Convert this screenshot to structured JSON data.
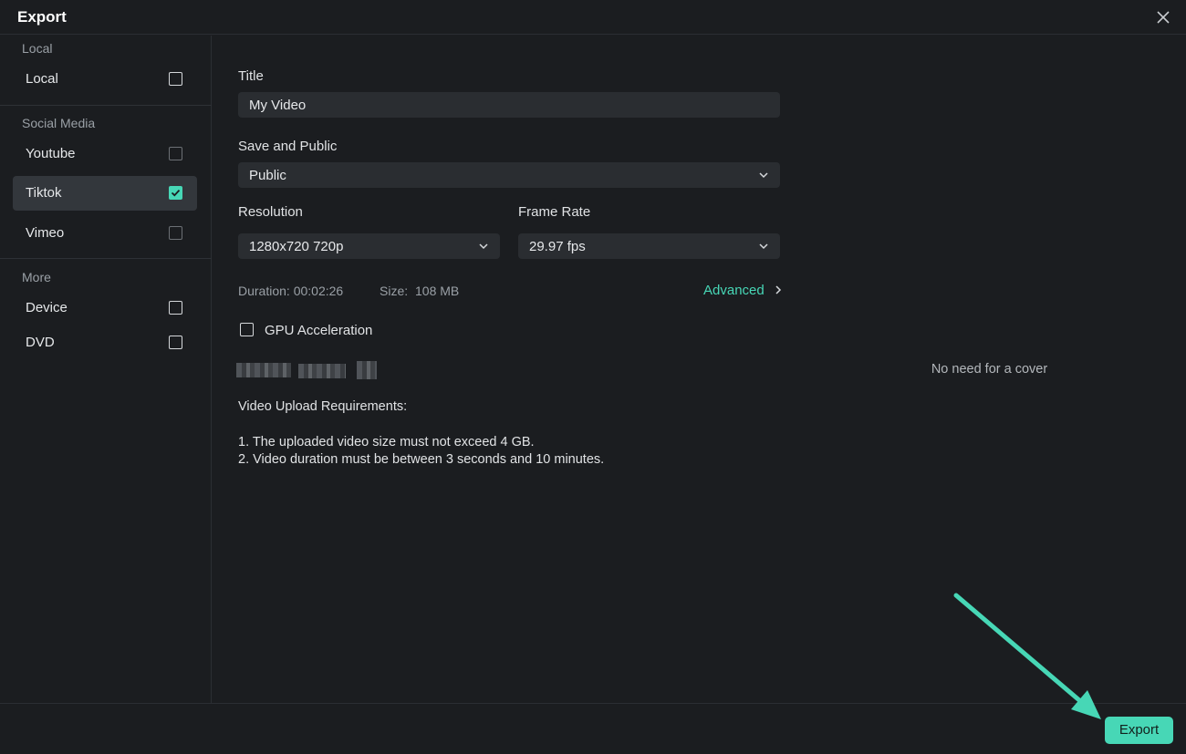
{
  "window": {
    "title": "Export",
    "close_icon": "close-icon"
  },
  "sidebar": {
    "sections": [
      {
        "header": "Local",
        "items": [
          {
            "label": "Local",
            "checked": false,
            "selected": false
          }
        ]
      },
      {
        "header": "Social Media",
        "items": [
          {
            "label": "Youtube",
            "checked": false,
            "selected": false
          },
          {
            "label": "Tiktok",
            "checked": true,
            "selected": true
          },
          {
            "label": "Vimeo",
            "checked": false,
            "selected": false
          }
        ]
      },
      {
        "header": "More",
        "items": [
          {
            "label": "Device",
            "checked": false,
            "selected": false
          },
          {
            "label": "DVD",
            "checked": false,
            "selected": false
          }
        ]
      }
    ]
  },
  "form": {
    "title_label": "Title",
    "title_value": "My Video",
    "privacy_label": "Save and Public",
    "privacy_value": "Public",
    "resolution_label": "Resolution",
    "resolution_value": "1280x720 720p",
    "framerate_label": "Frame Rate",
    "framerate_value": "29.97 fps",
    "duration_label": "Duration:",
    "duration_value": "00:02:26",
    "size_label": "Size:",
    "size_value": "108 MB",
    "advanced_label": "Advanced",
    "gpu_label": "GPU Acceleration",
    "gpu_checked": false,
    "requirements_title": "Video Upload Requirements:",
    "requirement_1": "1. The uploaded video size must not exceed 4 GB.",
    "requirement_2": "2. Video duration must be between 3 seconds and 10 minutes."
  },
  "cover": {
    "message": "No need for a cover"
  },
  "footer": {
    "export_label": "Export"
  },
  "colors": {
    "accent": "#47d7b6",
    "background": "#1b1d20",
    "field_bg": "#2a2d31",
    "selected_bg": "#33373c"
  }
}
